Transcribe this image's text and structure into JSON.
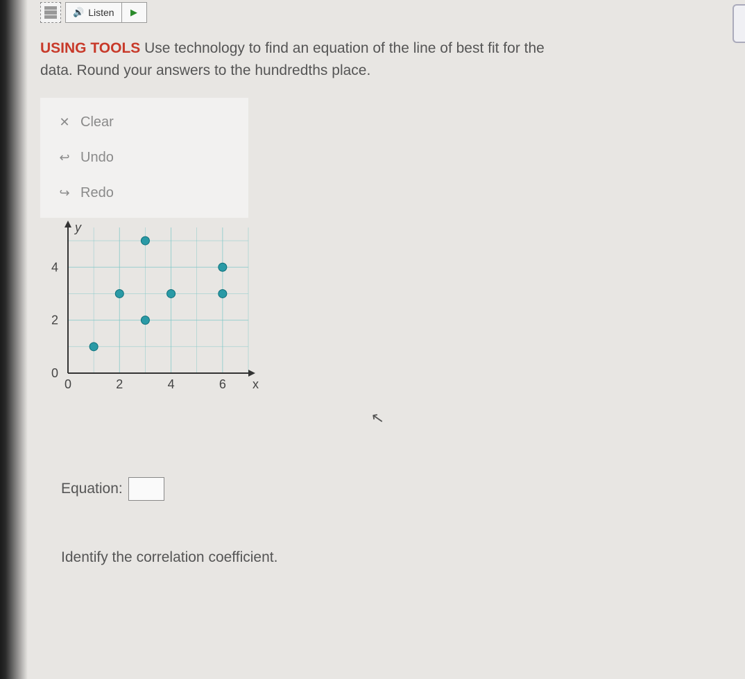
{
  "toolbar": {
    "listen_label": "Listen"
  },
  "prompt": {
    "heading": "USING TOOLS",
    "body_1": " Use technology to find an equation of the line of best fit for the",
    "body_2": "data. Round your answers to the hundredths place."
  },
  "panel": {
    "clear": "Clear",
    "undo": "Undo",
    "redo": "Redo"
  },
  "equation": {
    "label": "Equation:"
  },
  "correlation": {
    "label": "Identify the correlation coefficient."
  },
  "chart_data": {
    "type": "scatter",
    "xlabel": "x",
    "ylabel": "y",
    "xlim": [
      0,
      7
    ],
    "ylim": [
      0,
      5.5
    ],
    "xticks": [
      0,
      2,
      4,
      6
    ],
    "yticks": [
      0,
      2,
      4
    ],
    "points": [
      {
        "x": 1,
        "y": 1
      },
      {
        "x": 2,
        "y": 3
      },
      {
        "x": 3,
        "y": 2
      },
      {
        "x": 3,
        "y": 5
      },
      {
        "x": 4,
        "y": 3
      },
      {
        "x": 6,
        "y": 4
      },
      {
        "x": 6,
        "y": 3
      }
    ]
  }
}
